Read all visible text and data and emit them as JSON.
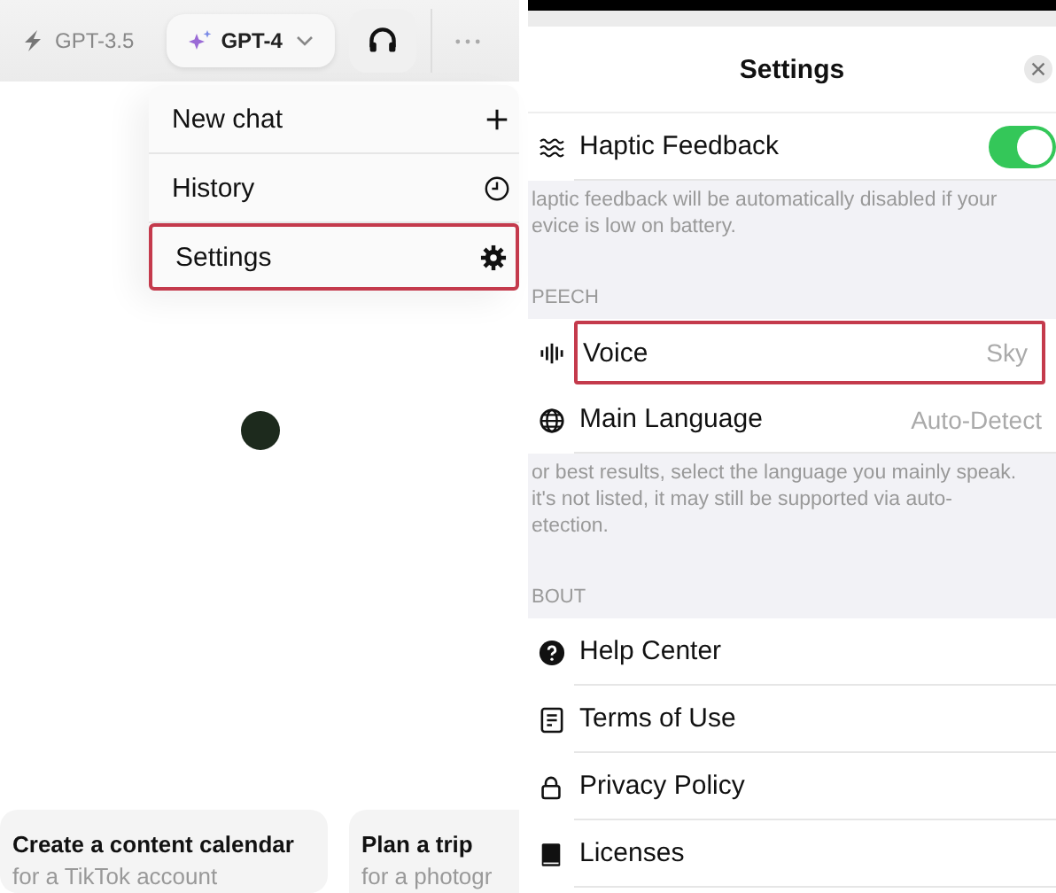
{
  "left": {
    "models": [
      {
        "label": "GPT-3.5",
        "selected": false
      },
      {
        "label": "GPT-4",
        "selected": true
      }
    ],
    "menu": [
      {
        "label": "New chat",
        "highlighted": false
      },
      {
        "label": "History",
        "highlighted": false
      },
      {
        "label": "Settings",
        "highlighted": true
      }
    ],
    "suggestions": [
      {
        "title": "Create a content calendar",
        "subtitle": "for a TikTok account"
      },
      {
        "title": "Plan a trip",
        "subtitle": "for a photogr"
      }
    ]
  },
  "right": {
    "title": "Settings",
    "sections": [
      {
        "rows": [
          {
            "label": "Haptic Feedback",
            "kind": "toggle",
            "on": true,
            "highlighted": false
          }
        ],
        "note": [
          "laptic feedback will be automatically disabled if your",
          "evice is low on battery."
        ]
      },
      {
        "header": "PEECH",
        "rows": [
          {
            "label": "Voice",
            "kind": "value",
            "value": "Sky",
            "highlighted": true
          },
          {
            "label": "Main Language",
            "kind": "value",
            "value": "Auto-Detect",
            "highlighted": false
          }
        ],
        "note": [
          "or best results, select the language you mainly speak.",
          "it's not listed, it may still be supported via auto-",
          "etection."
        ]
      },
      {
        "header": "BOUT",
        "rows": [
          {
            "label": "Help Center",
            "kind": "link",
            "highlighted": false
          },
          {
            "label": "Terms of Use",
            "kind": "link",
            "highlighted": false
          },
          {
            "label": "Privacy Policy",
            "kind": "link",
            "highlighted": false
          },
          {
            "label": "Licenses",
            "kind": "link",
            "highlighted": false
          }
        ]
      }
    ]
  }
}
